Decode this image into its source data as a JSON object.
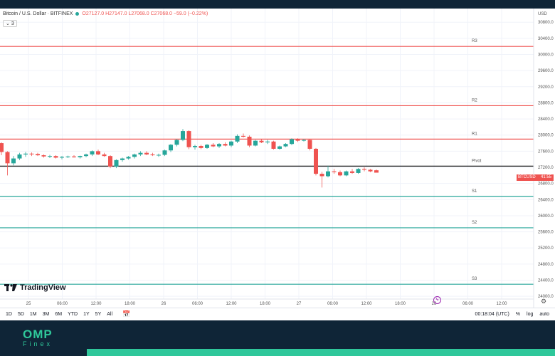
{
  "header": {
    "symbol": "Bitcoin / U.S. Dollar · BITFINEX",
    "open": "O27127.0",
    "high": "H27147.0",
    "low": "L27068.0",
    "close": "C27068.0",
    "change": "−59.0 (−0.22%)",
    "indicator_count": "3"
  },
  "price_axis": {
    "currency": "USD",
    "last_price_label": "BTCUSD",
    "countdown": "41:55"
  },
  "branding": {
    "tv_logo": "TradingView",
    "omp_line1": "OMP",
    "omp_line2": "Finex"
  },
  "bottom_bar": {
    "ranges": [
      "1D",
      "5D",
      "1M",
      "3M",
      "6M",
      "YTD",
      "1Y",
      "5Y",
      "All"
    ],
    "time": "00:18:04 (UTC)",
    "pct": "%",
    "log": "log",
    "auto": "auto"
  },
  "chart_data": {
    "type": "candlestick",
    "symbol": "BTCUSD",
    "y_ticks": [
      24000,
      24400,
      24800,
      25200,
      25600,
      26000,
      26400,
      26800,
      27200,
      27600,
      28000,
      28400,
      28800,
      29200,
      29600,
      30000,
      30400,
      30800
    ],
    "ylim": [
      23720,
      31140
    ],
    "x_ticks": [
      "25",
      "06:00",
      "12:00",
      "18:00",
      "26",
      "06:00",
      "12:00",
      "18:00",
      "27",
      "06:00",
      "12:00",
      "18:00",
      "28",
      "06:00",
      "12:00"
    ],
    "levels": [
      {
        "name": "R3",
        "value": 30200,
        "color": "#ef5350"
      },
      {
        "name": "R2",
        "value": 28730,
        "color": "#ef5350"
      },
      {
        "name": "R1",
        "value": 27900,
        "color": "#ef5350"
      },
      {
        "name": "Pivot",
        "value": 27230,
        "color": "#000000"
      },
      {
        "name": "S1",
        "value": 26480,
        "color": "#26a69a"
      },
      {
        "name": "S2",
        "value": 25700,
        "color": "#26a69a"
      },
      {
        "name": "S3",
        "value": 24300,
        "color": "#26a69a"
      }
    ],
    "candles": [
      [
        27800,
        27820,
        27500,
        27580
      ],
      [
        27580,
        27600,
        27000,
        27300
      ],
      [
        27300,
        27480,
        27250,
        27420
      ],
      [
        27420,
        27560,
        27380,
        27520
      ],
      [
        27520,
        27580,
        27460,
        27540
      ],
      [
        27540,
        27570,
        27480,
        27530
      ],
      [
        27530,
        27560,
        27480,
        27500
      ],
      [
        27500,
        27520,
        27440,
        27470
      ],
      [
        27470,
        27510,
        27430,
        27480
      ],
      [
        27480,
        27500,
        27420,
        27440
      ],
      [
        27440,
        27480,
        27400,
        27460
      ],
      [
        27460,
        27490,
        27430,
        27470
      ],
      [
        27470,
        27500,
        27440,
        27450
      ],
      [
        27450,
        27490,
        27420,
        27480
      ],
      [
        27480,
        27540,
        27450,
        27520
      ],
      [
        27520,
        27620,
        27480,
        27600
      ],
      [
        27600,
        27640,
        27500,
        27520
      ],
      [
        27520,
        27560,
        27460,
        27480
      ],
      [
        27480,
        27500,
        27180,
        27220
      ],
      [
        27220,
        27400,
        27180,
        27380
      ],
      [
        27380,
        27440,
        27340,
        27420
      ],
      [
        27420,
        27480,
        27390,
        27460
      ],
      [
        27460,
        27540,
        27420,
        27520
      ],
      [
        27520,
        27600,
        27480,
        27560
      ],
      [
        27560,
        27600,
        27500,
        27520
      ],
      [
        27520,
        27560,
        27480,
        27500
      ],
      [
        27500,
        27540,
        27460,
        27510
      ],
      [
        27510,
        27640,
        27480,
        27620
      ],
      [
        27620,
        27780,
        27580,
        27760
      ],
      [
        27760,
        27900,
        27720,
        27880
      ],
      [
        27880,
        28150,
        27850,
        28100
      ],
      [
        28100,
        28120,
        27650,
        27700
      ],
      [
        27700,
        27760,
        27640,
        27730
      ],
      [
        27730,
        27760,
        27650,
        27680
      ],
      [
        27680,
        27780,
        27660,
        27760
      ],
      [
        27760,
        27800,
        27700,
        27720
      ],
      [
        27720,
        27800,
        27680,
        27780
      ],
      [
        27780,
        27820,
        27720,
        27740
      ],
      [
        27740,
        27860,
        27700,
        27840
      ],
      [
        27840,
        28020,
        27800,
        27980
      ],
      [
        27980,
        28040,
        27940,
        27960
      ],
      [
        27960,
        27990,
        27700,
        27740
      ],
      [
        27740,
        27880,
        27720,
        27860
      ],
      [
        27860,
        27900,
        27800,
        27820
      ],
      [
        27820,
        27880,
        27780,
        27840
      ],
      [
        27840,
        27860,
        27640,
        27660
      ],
      [
        27660,
        27740,
        27640,
        27720
      ],
      [
        27720,
        27800,
        27700,
        27780
      ],
      [
        27780,
        27920,
        27750,
        27900
      ],
      [
        27900,
        27920,
        27830,
        27860
      ],
      [
        27860,
        27900,
        27840,
        27880
      ],
      [
        27880,
        27890,
        27620,
        27660
      ],
      [
        27660,
        27680,
        27000,
        27040
      ],
      [
        27040,
        27090,
        26700,
        26980
      ],
      [
        26980,
        27240,
        26950,
        27100
      ],
      [
        27100,
        27160,
        27040,
        27080
      ],
      [
        27080,
        27120,
        26980,
        27000
      ],
      [
        27000,
        27120,
        26980,
        27100
      ],
      [
        27100,
        27160,
        27040,
        27060
      ],
      [
        27060,
        27180,
        27040,
        27160
      ],
      [
        27160,
        27200,
        27100,
        27140
      ],
      [
        27140,
        27160,
        27080,
        27100
      ],
      [
        27127,
        27147,
        27068,
        27068
      ]
    ]
  }
}
